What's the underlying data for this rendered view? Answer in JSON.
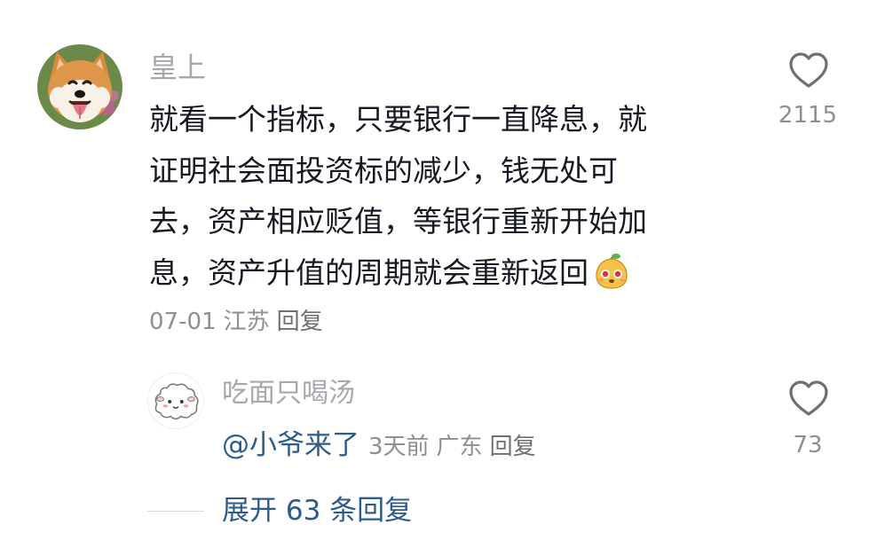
{
  "comment": {
    "username": "皇上",
    "text_lines": [
      "就看一个指标，只要银行一直降息，就",
      "证明社会面投资标的减少，钱无处可",
      "去，资产相应贬值，等银行重新开始加",
      "息，资产升值的周期就会重新返回"
    ],
    "date": "07-01",
    "location": "江苏",
    "reply_label": "回复",
    "like_count": "2115",
    "emoji_icon": "pear-face-emoji",
    "like_icon": "heart-outline-icon"
  },
  "reply": {
    "username": "吃面只喝汤",
    "mention": "@小爷来了",
    "time": "3天前",
    "location": "广东",
    "reply_label": "回复",
    "like_count": "73",
    "like_icon": "heart-outline-icon"
  },
  "expand": {
    "label": "展开 63 条回复"
  },
  "colors": {
    "username_gray": "#a7a8ad",
    "meta_gray": "#8e8f94",
    "link_blue": "#2c5b8e",
    "text_dark": "#161823"
  }
}
